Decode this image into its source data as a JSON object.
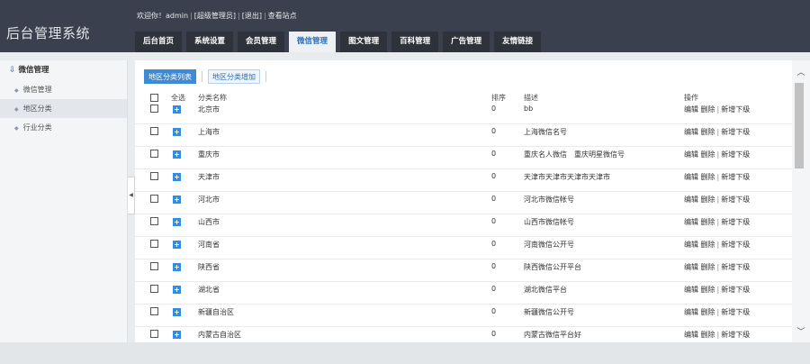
{
  "app_title": "后台管理系统",
  "welcome": {
    "greeting": "欢迎你！admin",
    "role": "[超级管理员]",
    "logout": "[退出]",
    "view_site": "查看站点"
  },
  "nav": [
    {
      "label": "后台首页"
    },
    {
      "label": "系统设置"
    },
    {
      "label": "会员管理"
    },
    {
      "label": "微信管理"
    },
    {
      "label": "图文管理"
    },
    {
      "label": "百科管理"
    },
    {
      "label": "广告管理"
    },
    {
      "label": "友情链接"
    }
  ],
  "sidebar": {
    "title": "微信管理",
    "items": [
      {
        "label": "微信管理"
      },
      {
        "label": "地区分类"
      },
      {
        "label": "行业分类"
      }
    ]
  },
  "toolbar": {
    "list_label": "地区分类列表",
    "add_label": "地区分类增加"
  },
  "table": {
    "headers": {
      "select_all": "全选",
      "name": "分类名称",
      "sort": "排序",
      "desc": "描述",
      "ops": "操作"
    },
    "op_labels": {
      "edit": "编辑",
      "delete": "删除",
      "add_child": "新增下级"
    },
    "rows": [
      {
        "name": "北京市",
        "sort": "0",
        "desc": "bb"
      },
      {
        "name": "上海市",
        "sort": "0",
        "desc": "上海微信名号"
      },
      {
        "name": "重庆市",
        "sort": "0",
        "desc": "重庆名人微信　重庆明星微信号"
      },
      {
        "name": "天津市",
        "sort": "0",
        "desc": "天津市天津市天津市天津市"
      },
      {
        "name": "河北市",
        "sort": "0",
        "desc": "河北市微信帐号"
      },
      {
        "name": "山西市",
        "sort": "0",
        "desc": "山西市微信帐号"
      },
      {
        "name": "河南省",
        "sort": "0",
        "desc": "河南微信公开号"
      },
      {
        "name": "陕西省",
        "sort": "0",
        "desc": "陕西微信公开平台"
      },
      {
        "name": "湖北省",
        "sort": "0",
        "desc": "湖北微信平台"
      },
      {
        "name": "新疆自治区",
        "sort": "0",
        "desc": "新疆微信公开号"
      },
      {
        "name": "内蒙古自治区",
        "sort": "0",
        "desc": "内蒙古微信平台好"
      }
    ]
  }
}
